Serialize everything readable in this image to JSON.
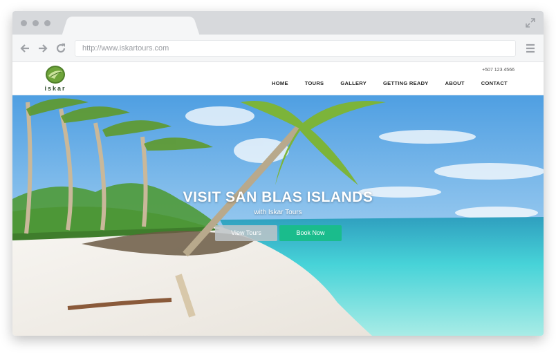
{
  "browser": {
    "url": "http://www.iskartours.com"
  },
  "header": {
    "logo_text": "iskar",
    "phone": "+507 123 4566",
    "nav": [
      "HOME",
      "TOURS",
      "GALLERY",
      "GETTING READY",
      "ABOUT",
      "CONTACT"
    ]
  },
  "hero": {
    "title": "VISIT SAN BLAS ISLANDS",
    "subtitle": "with Iskar Tours",
    "view_button": "View Tours",
    "book_button": "Book Now"
  },
  "colors": {
    "accent": "#1abc8c",
    "sky": "#5aa9e6",
    "sea": "#3fd1d6",
    "sand": "#f2efea"
  },
  "icons": [
    "back-arrow-icon",
    "forward-arrow-icon",
    "reload-icon",
    "expand-icon",
    "hamburger-menu-icon"
  ]
}
